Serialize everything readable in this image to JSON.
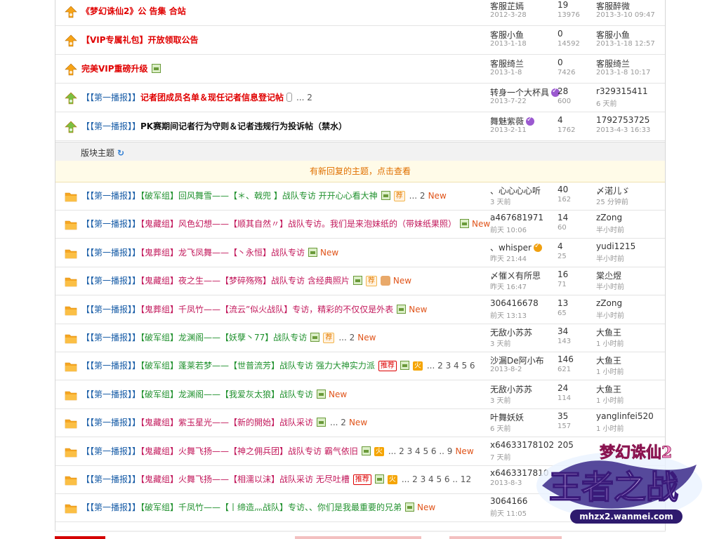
{
  "pinned": [
    {
      "title": "《梦幻诛仙2》公 告集 合站",
      "style": "red",
      "author": "客服芷嫣",
      "date": "2012-3-28",
      "replies": "19",
      "views": "13976",
      "last_user": "客服醉微",
      "last_time": "2013-3-10 09:47",
      "icon": "orange"
    },
    {
      "title": "【VIP专属礼包】开放领取公告",
      "style": "red",
      "author": "客服小鱼",
      "date": "2013-1-18",
      "replies": "0",
      "views": "14592",
      "last_user": "客服小鱼",
      "last_time": "2013-1-18 12:57",
      "icon": "orange"
    },
    {
      "title": "完美VIP重磅升级",
      "style": "red",
      "mini": true,
      "author": "客服绮兰",
      "date": "2013-1-8",
      "replies": "0",
      "views": "7426",
      "last_user": "客服绮兰",
      "last_time": "2013-1-8 10:17",
      "icon": "orange"
    },
    {
      "tag": "【【第一播报】】",
      "title": "记者团成员名单＆现任记者信息登记帖",
      "style": "red",
      "clip": true,
      "pages": "... 2",
      "author": "转身一个大杯具",
      "verify": "purple",
      "date": "2013-7-22",
      "replies": "28",
      "views": "600",
      "last_user": "r329315411",
      "last_time": "6 天前",
      "icon": "green"
    },
    {
      "tag": "【【第一播报】】",
      "title": "PK赛期间记者行为守则＆记者违规行为投诉帖（禁水）",
      "style": "black",
      "author": "舞魅紫薇",
      "verify": "purple",
      "date": "2013-2-11",
      "replies": "4",
      "views": "1762",
      "last_user": "1792753725",
      "last_time": "2013-4-3 16:33",
      "icon": "green"
    }
  ],
  "section": {
    "label": "版块主题",
    "refresh_icon": "refresh-icon"
  },
  "notice": {
    "text": "有新回复的主题，点击查看"
  },
  "new_label": "New",
  "threads": [
    {
      "tag": "【【第一播报】】",
      "group": "【破军组】",
      "group_color": "green",
      "title": "回风舞雪——【＊、戟兜 】战队专访 开开心心看大神",
      "mini": true,
      "badges": [
        "hot"
      ],
      "pages": "... 2",
      "new": true,
      "author": "、心心心心听",
      "date": "3 天前",
      "replies": "40",
      "views": "162",
      "last_user": "〆渃儿ゞ",
      "last_time": "25 分钟前"
    },
    {
      "tag": "【【第一播报】】",
      "group": "【鬼藏组】",
      "group_color": "pink",
      "title": "风色幻想——【顺其自然〃】战队专访。我们是来泡妹纸的（带妹纸果照）",
      "mini": true,
      "badges": [],
      "pages": "",
      "new": true,
      "author": "a467681971",
      "date": "前天 10:06",
      "replies": "14",
      "views": "60",
      "last_user": "zZong",
      "last_time": "半小时前"
    },
    {
      "tag": "【【第一播报】】",
      "group": "【鬼葬组】",
      "group_color": "pink",
      "title": "龙飞凤舞——【丶永恒】战队专访",
      "mini": true,
      "badges": [],
      "pages": "",
      "new": true,
      "author": "、whisper",
      "verify": "orange",
      "date": "昨天 21:44",
      "replies": "4",
      "views": "25",
      "last_user": "yudi1215",
      "last_time": "半小时前"
    },
    {
      "tag": "【【第一播报】】",
      "group": "【鬼藏组】",
      "group_color": "pink",
      "title": "夜之生——【梦碎殇殇】战队专访 含经典照片",
      "mini": true,
      "badges": [
        "hot",
        "thumb"
      ],
      "pages": "",
      "new": true,
      "author": "〆慛ㄨ有所思",
      "date": "昨天 16:47",
      "replies": "16",
      "views": "71",
      "last_user": "棠尐煜",
      "last_time": "半小时前"
    },
    {
      "tag": "【【第一播报】】",
      "group": "【鬼葬组】",
      "group_color": "pink",
      "title": "千凤竹——【流云”似火战队】专访，精彩的不仅仅是外表",
      "mini": true,
      "badges": [],
      "pages": "",
      "new": true,
      "author": "306416678",
      "date": "前天 13:13",
      "replies": "13",
      "views": "65",
      "last_user": "zZong",
      "last_time": "半小时前"
    },
    {
      "tag": "【【第一播报】】",
      "group": "【破军组】",
      "group_color": "green",
      "title": "龙渊阁——【妖孽丶77】战队专访",
      "mini": true,
      "badges": [
        "hot"
      ],
      "pages": "... 2",
      "new": true,
      "author": "无敌小苏苏",
      "date": "3 天前",
      "replies": "34",
      "views": "143",
      "last_user": "大鱼王",
      "last_time": "1 小时前"
    },
    {
      "tag": "【【第一播报】】",
      "group": "【破军组】",
      "group_color": "green",
      "title": "蓬莱若梦——【世普流芳】战队专访 强力大神实力派",
      "mini": false,
      "badges": [
        "tj",
        "mini",
        "huo"
      ],
      "pages": "... 2 3 4 5 6",
      "new": false,
      "author": "沙漏De阿小布",
      "date": "2013-8-2",
      "replies": "146",
      "views": "621",
      "last_user": "大鱼王",
      "last_time": "1 小时前"
    },
    {
      "tag": "【【第一播报】】",
      "group": "【破军组】",
      "group_color": "green",
      "title": "龙渊阁——【我爱灰太狼】战队专访",
      "mini": true,
      "badges": [],
      "pages": "",
      "new": true,
      "author": "无敌小苏苏",
      "date": "3 天前",
      "replies": "24",
      "views": "114",
      "last_user": "大鱼王",
      "last_time": "1 小时前"
    },
    {
      "tag": "【【第一播报】】",
      "group": "【鬼藏组】",
      "group_color": "pink",
      "title": "紫玉星光——【新的開始】战队采访",
      "mini": true,
      "badges": [],
      "pages": "... 2",
      "new": true,
      "author": "叶舞妖妖",
      "date": "6 天前",
      "replies": "35",
      "views": "157",
      "last_user": "yanglinfei520",
      "last_time": "1 小时前"
    },
    {
      "tag": "【【第一播报】】",
      "group": "【鬼藏组】",
      "group_color": "pink",
      "title": "火舞飞扬——【神之佣兵团】战队专访 霸气依旧",
      "mini": true,
      "badges": [
        "huo"
      ],
      "pages": "... 2 3 4 5 6 .. 9",
      "new": true,
      "author": "x64633178102",
      "date": "7 天前",
      "replies": "205",
      "views": "",
      "last_user": "",
      "last_time": ""
    },
    {
      "tag": "【【第一播报】】",
      "group": "【鬼藏组】",
      "group_color": "pink",
      "title": "火舞飞扬——【相濡以沫】战队采访 无尽吐槽",
      "mini": false,
      "badges": [
        "tj",
        "mini",
        "huo"
      ],
      "pages": "... 2 3 4 5 6 .. 12",
      "new": false,
      "author": "x6463317810",
      "date": "2013-8-3",
      "replies": "",
      "views": "",
      "last_user": "",
      "last_time": ""
    },
    {
      "tag": "【【第一播报】】",
      "group": "【破军组】",
      "group_color": "green",
      "title": "千凤竹——【丨缔造灬战队】专访、、你们是我最重要的兄弟",
      "mini": true,
      "badges": [],
      "pages": "",
      "new": true,
      "author": "3064166",
      "date": "前天 11:05",
      "replies": "",
      "views": "",
      "last_user": "",
      "last_time": ""
    }
  ],
  "badge_text": {
    "hot": "荐",
    "huo": "火",
    "tj": "推荐"
  },
  "logo": {
    "line1": "梦幻诛仙2",
    "line2": "王者之战",
    "url": "mhzx2.wanmei.com"
  },
  "colors": {
    "red": "#e00000",
    "green": "#20912e",
    "pink": "#c2185b",
    "blue": "#1a5ea8",
    "new": "#e0541a",
    "notice": "#e07000"
  }
}
